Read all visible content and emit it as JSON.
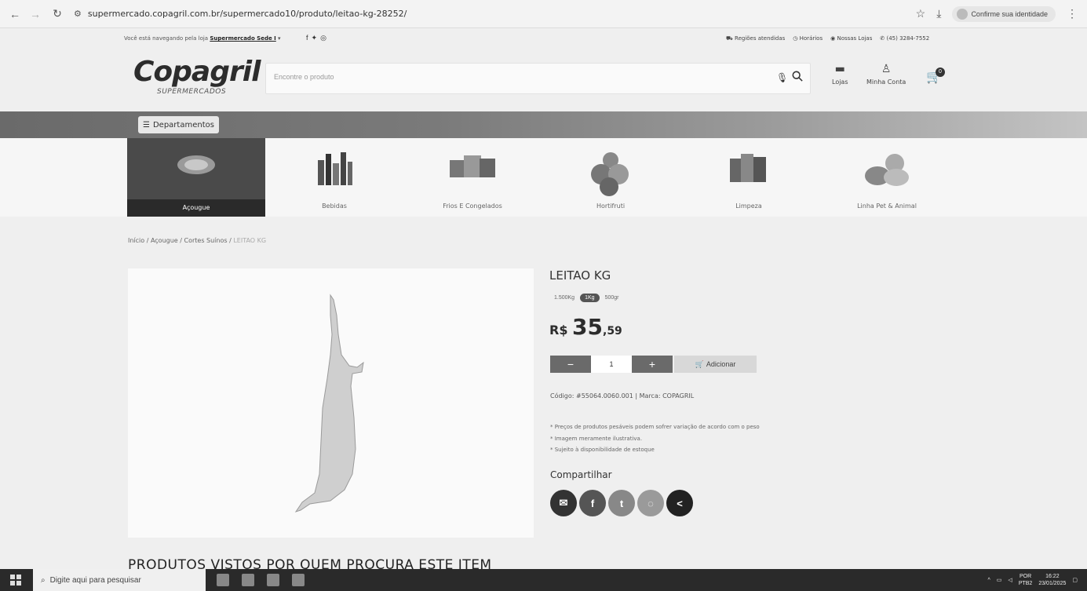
{
  "browser": {
    "url": "supermercado.copagril.com.br/supermercado10/produto/leitao-kg-28252/",
    "identity_label": "Confirme sua identidade"
  },
  "topbar": {
    "store_prefix": "Você está navegando pela loja ",
    "store_name": "Supermercado Sede I",
    "links": [
      "Regiões atendidas",
      "Horários",
      "Nossas Lojas",
      "(45) 3284-7552"
    ]
  },
  "header": {
    "logo": "Copagril",
    "logo_sub": "SUPERMERCADOS",
    "search_placeholder": "Encontre o produto",
    "stores_label": "Lojas",
    "account_label": "Minha Conta",
    "cart_count": "0"
  },
  "departments_label": "Departamentos",
  "categories": [
    {
      "label": "Açougue",
      "active": true
    },
    {
      "label": "Bebidas",
      "active": false
    },
    {
      "label": "Frios E Congelados",
      "active": false
    },
    {
      "label": "Hortifruti",
      "active": false
    },
    {
      "label": "Limpeza",
      "active": false
    },
    {
      "label": "Linha Pet & Animal",
      "active": false
    }
  ],
  "breadcrumb": {
    "path": "Início / Açougue / Cortes Suínos / ",
    "current": "LEITAO KG"
  },
  "product": {
    "title": "LEITAO KG",
    "weights": [
      "1.500Kg",
      "1Kg",
      "500gr"
    ],
    "price_currency": "R$",
    "price_int": "35",
    "price_dec": ",59",
    "qty_minus": "−",
    "qty_value": "1",
    "qty_plus": "+",
    "add_label": "Adicionar",
    "code_line": "Código: #55064.0060.001 | Marca: COPAGRIL",
    "notes": [
      "* Preços de produtos pesáveis podem sofrer variação de acordo com o peso",
      "* Imagem meramente ilustrativa.",
      "* Sujeito à disponibilidade de estoque"
    ],
    "share_title": "Compartilhar"
  },
  "related_title": "PRODUTOS VISTOS POR QUEM PROCURA ESTE ITEM",
  "taskbar": {
    "search_placeholder": "Digite aqui para pesquisar",
    "lang": "POR",
    "lang2": "PTB2",
    "time": "16:22",
    "date": "23/01/2025"
  }
}
